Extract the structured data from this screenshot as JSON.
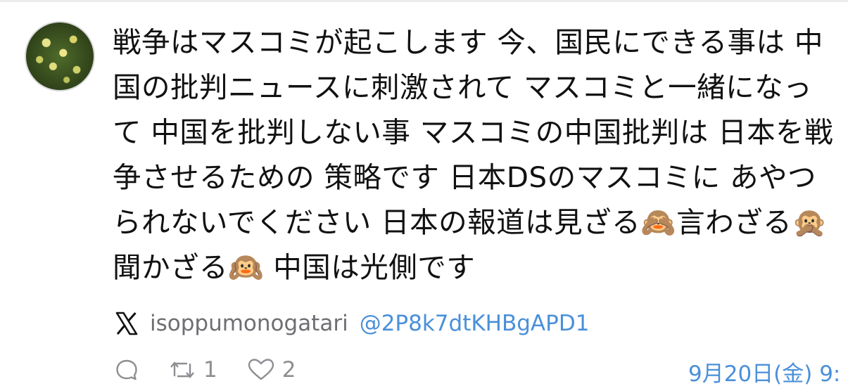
{
  "post": {
    "text": "戦争はマスコミが起こします 今、国民にできる事は 中国の批判ニュースに刺激されて マスコミと一緒になって 中国を批判しない事 マスコミの中国批判は 日本を戦争させるための 策略です 日本DSのマスコミに あやつられないでください 日本の報道は見ざる🙈言わざる🙊聞かざる🙉 中国は光側です",
    "avatar_icon": "flower-field-avatar",
    "source_icon": "x-logo-icon",
    "username": "isoppumonogatari",
    "handle": "@2P8k7dtKHBgAPD1",
    "timestamp": "9月20日(金) 9:"
  },
  "actions": {
    "reply_icon": "reply-bubble-icon",
    "repost_icon": "repost-icon",
    "repost_count": "1",
    "like_icon": "heart-icon",
    "like_count": "2"
  },
  "colors": {
    "text": "#111111",
    "muted": "#8e8e93",
    "link": "#4a90d9"
  }
}
